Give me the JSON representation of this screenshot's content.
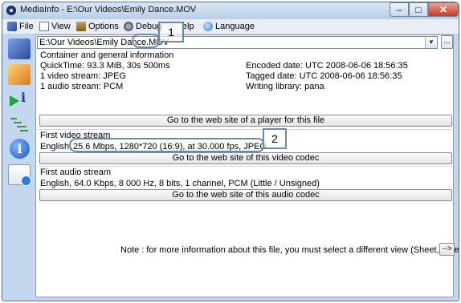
{
  "window": {
    "title": "MediaInfo - E:\\Our Videos\\Emily Dance.MOV",
    "minimize": "–",
    "maximize": "□",
    "close": "✕"
  },
  "menu": {
    "items": [
      "File",
      "View",
      "Options",
      "Debug",
      "Help",
      "Language"
    ],
    "help_visible": "elp"
  },
  "file_selector": {
    "value": "E:\\Our Videos\\Emily Dance.MOV",
    "browse": "..."
  },
  "general": {
    "header": "Container and general information",
    "left": [
      "QuickTime: 93.3 MiB, 30s 500ms",
      "1 video stream: JPEG",
      "1 audio stream: PCM"
    ],
    "right": [
      "Encoded date: UTC 2008-06-06 18:56:35",
      "Tagged date: UTC 2008-06-06 18:56:35",
      "Writing library: pana"
    ],
    "button": "Go to the web site of a player for this file"
  },
  "video": {
    "header": "First video stream",
    "lang": "English,",
    "details": "25.6 Mbps, 1280*720 (16:9), at 30.000 fps, JPEG",
    "button": "Go to the web site of this video codec"
  },
  "audio": {
    "header": "First audio stream",
    "details": "English, 64.0 Kbps, 8 000 Hz, 8 bits, 1 channel, PCM (Little / Unsigned)",
    "button": "Go to the web site of this audio codec"
  },
  "note": {
    "text": "Note : for more information about this file, you must select a different view (Sheet, Tree...)",
    "button": "-->"
  },
  "callouts": {
    "one": "1",
    "two": "2"
  },
  "colors": {
    "accent": "#6e87ad",
    "frame": "#c3d7ee"
  },
  "icons": [
    "app-icon",
    "file-icon",
    "view-icon",
    "options-icon",
    "debug-icon",
    "language-icon",
    "basic-view-icon",
    "sheet-view-icon",
    "tree-view-icon",
    "text-view-icon",
    "info-icon",
    "export-icon",
    "dropdown-arrow-icon"
  ]
}
